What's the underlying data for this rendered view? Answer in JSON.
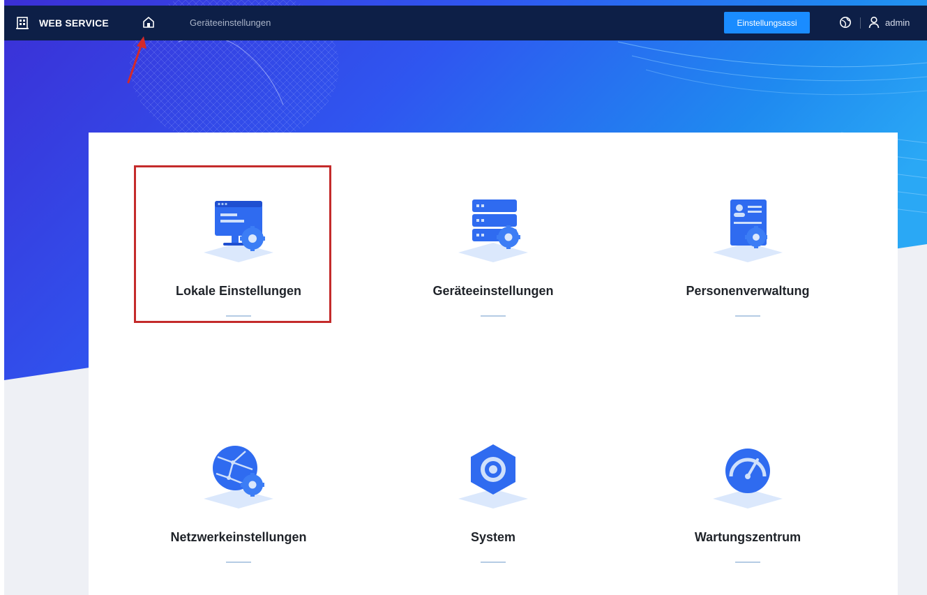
{
  "header": {
    "brand_label": "WEB SERVICE",
    "breadcrumb": "Geräteeinstellungen",
    "wizard_button": "Einstellungsassi",
    "user_name": "admin",
    "icons": {
      "brand": "building-icon",
      "home": "home-icon",
      "language": "globe-icon",
      "user": "user-icon"
    }
  },
  "tiles": [
    {
      "label": "Lokale Einstellungen",
      "icon": "monitor-settings-icon",
      "highlighted": true
    },
    {
      "label": "Geräteeinstellungen",
      "icon": "server-settings-icon"
    },
    {
      "label": "Personenverwaltung",
      "icon": "person-card-settings-icon"
    },
    {
      "label": "Netzwerkeinstellungen",
      "icon": "network-globe-settings-icon"
    },
    {
      "label": "System",
      "icon": "system-gear-icon"
    },
    {
      "label": "Wartungszentrum",
      "icon": "gauge-icon"
    }
  ],
  "colors": {
    "header_bg": "#0d1f47",
    "accent": "#1a8cff",
    "icon_blue": "#2f6bf0",
    "icon_light": "#a9c8f5",
    "highlight": "#c42b2b",
    "annotation_arrow": "#d42a2a"
  }
}
